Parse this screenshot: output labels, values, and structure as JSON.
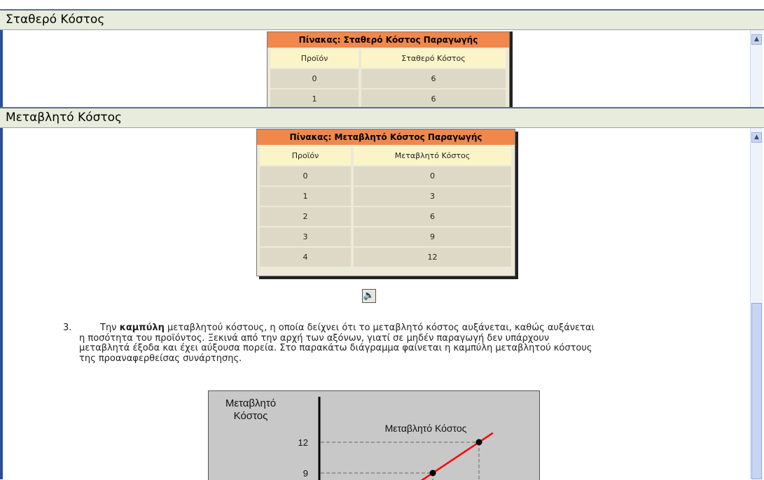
{
  "panels": [
    {
      "title": "Σταθερό Κόστος"
    },
    {
      "title": "Μεταβλητό Κόστος"
    }
  ],
  "fixed_table": {
    "title": "Πίνακας: Σταθερό Κόστος Παραγωγής",
    "headers": [
      "Προϊόν",
      "Σταθερό Κόστος"
    ],
    "rows": [
      [
        "0",
        "6"
      ],
      [
        "1",
        "6"
      ]
    ]
  },
  "variable_table": {
    "title": "Πίνακας: Μεταβλητό Κόστος Παραγωγής",
    "headers": [
      "Προϊόν",
      "Μεταβλητό Κόστος"
    ],
    "rows": [
      [
        "0",
        "0"
      ],
      [
        "1",
        "3"
      ],
      [
        "2",
        "6"
      ],
      [
        "3",
        "9"
      ],
      [
        "4",
        "12"
      ]
    ]
  },
  "paragraph": {
    "number": "3.",
    "lead": "Την ",
    "bold": "καμπύλη",
    "text": " μεταβλητού κόστους, η οποία δείχνει ότι το μεταβλητό κόστος αυξάνεται, καθώς αυξάνεται η ποσότητα του προϊόντος. Ξεκινά από την αρχή των αξόνων, γιατί σε μηδέν παραγωγή δεν υπάρχουν μεταβλητά έξοδα και έχει αύξουσα πορεία. Στο παρακάτω διάγραμμα φαίνεται η καμπύλη μεταβλητού κόστους της προαναφερθείσας συνάρτησης."
  },
  "chart_data": {
    "type": "line",
    "title": "Μεταβλητό Κόστος",
    "ylabel": "Μεταβλητό Κόστος",
    "ytick_labels": [
      "12",
      "9"
    ],
    "series": [
      {
        "name": "Μεταβλητό Κόστος",
        "color": "#ff0000",
        "x": [
          3,
          4
        ],
        "y": [
          9,
          12
        ]
      }
    ]
  },
  "icons": {
    "sound": "speaker-icon",
    "scroll_up": "scroll-up-arrow-icon"
  }
}
